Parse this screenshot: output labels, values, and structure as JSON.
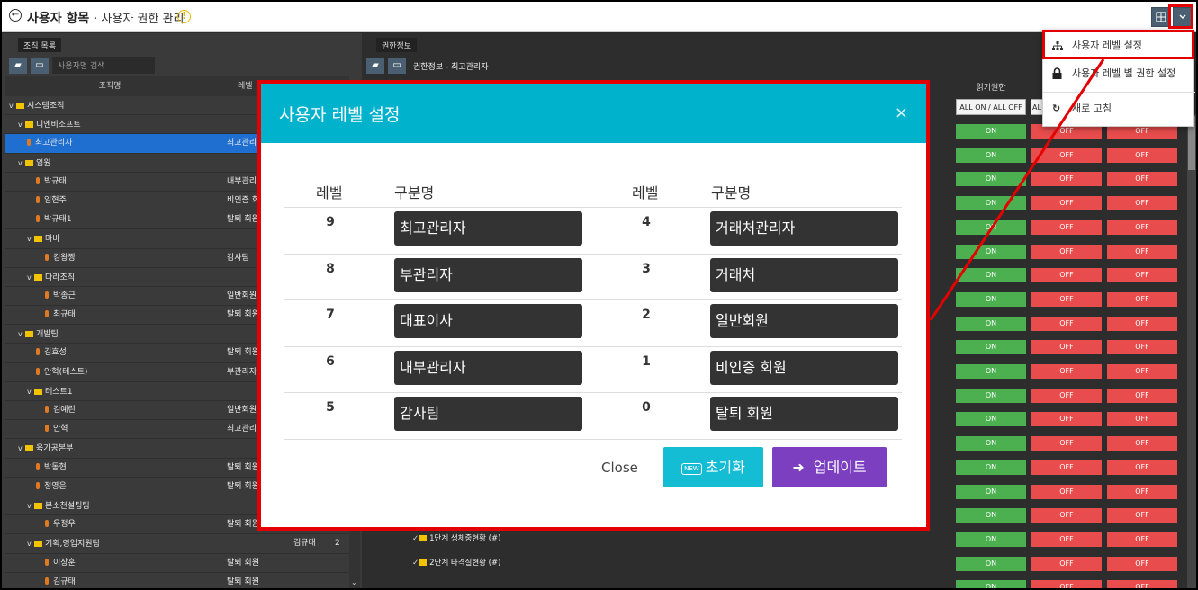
{
  "header": {
    "title": "사용자 항목",
    "subtitle": "· 사용자 권한 관리",
    "back_glyph": "←",
    "warn_glyph": "!"
  },
  "left_panel": {
    "tab": "조직 목록",
    "search_placeholder": "사용자명 검색",
    "col_name": "조직명",
    "col_level": "레벨",
    "rows": [
      {
        "name": "시스템조직",
        "type": "folder",
        "indent": 0,
        "level": ""
      },
      {
        "name": "디엔비소프트",
        "type": "folder",
        "indent": 1,
        "level": ""
      },
      {
        "name": "최고관리자",
        "type": "person",
        "indent": 2,
        "level": "최고관리",
        "selected": true
      },
      {
        "name": "임원",
        "type": "folder",
        "indent": 1,
        "level": ""
      },
      {
        "name": "박규태",
        "type": "person",
        "indent": 3,
        "level": "내부관리"
      },
      {
        "name": "임현주",
        "type": "person",
        "indent": 3,
        "level": "비인증 회"
      },
      {
        "name": "박규태1",
        "type": "person",
        "indent": 3,
        "level": "탈퇴 회원"
      },
      {
        "name": "마바",
        "type": "folder",
        "indent": 2,
        "level": ""
      },
      {
        "name": "킹왕짱",
        "type": "person",
        "indent": 4,
        "level": "감사팀"
      },
      {
        "name": "다라조직",
        "type": "folder",
        "indent": 2,
        "level": ""
      },
      {
        "name": "박종근",
        "type": "person",
        "indent": 4,
        "level": "일반회원"
      },
      {
        "name": "최규태",
        "type": "person",
        "indent": 4,
        "level": "탈퇴 회원"
      },
      {
        "name": "개발팀",
        "type": "folder",
        "indent": 1,
        "level": ""
      },
      {
        "name": "김효성",
        "type": "person",
        "indent": 3,
        "level": "탈퇴 회원"
      },
      {
        "name": "안혁(테스트)",
        "type": "person",
        "indent": 3,
        "level": "부관리자"
      },
      {
        "name": "테스트1",
        "type": "folder",
        "indent": 2,
        "level": ""
      },
      {
        "name": "김예린",
        "type": "person",
        "indent": 4,
        "level": "일반회원"
      },
      {
        "name": "안혁",
        "type": "person",
        "indent": 4,
        "level": "최고관리"
      },
      {
        "name": "육가공본부",
        "type": "folder",
        "indent": 1,
        "level": ""
      },
      {
        "name": "박동현",
        "type": "person",
        "indent": 3,
        "level": "탈퇴 회원"
      },
      {
        "name": "정영은",
        "type": "person",
        "indent": 3,
        "level": "탈퇴 회원"
      },
      {
        "name": "본소천설팅팀",
        "type": "folder",
        "indent": 2,
        "level": ""
      },
      {
        "name": "우정우",
        "type": "person",
        "indent": 4,
        "level": "탈퇴 회원"
      },
      {
        "name": "기획,영업지원팀",
        "type": "folder",
        "indent": 2,
        "level": "",
        "extra": "김규태",
        "extra2": "2"
      },
      {
        "name": "이상훈",
        "type": "person",
        "indent": 4,
        "level": "탈퇴 회원"
      },
      {
        "name": "김규태",
        "type": "person",
        "indent": 4,
        "level": "탈퇴 회원"
      }
    ]
  },
  "right_panel": {
    "tab": "권한정보",
    "breadcrumb": "권한정보 - 최고관리자",
    "read_col": "읽기권한",
    "all_toggle": "ALL ON / ALL OFF",
    "all_toggle_short": "AL",
    "on_label": "ON",
    "off_label": "OFF",
    "menu_rows": [
      {
        "label": "1단계 생체중현황 (#)"
      },
      {
        "label": "2단계 타격실현황 (#)"
      }
    ]
  },
  "dropdown": {
    "items": [
      {
        "label": "사용자 레벨 설정"
      },
      {
        "label": "사용자 레벨 별 권한 설정"
      },
      {
        "label": "새로 고침"
      }
    ]
  },
  "modal": {
    "title": "사용자 레벨 설정",
    "close_glyph": "×",
    "col_level": "레벨",
    "col_name": "구분명",
    "left_levels": [
      {
        "level": "9",
        "name": "최고관리자"
      },
      {
        "level": "8",
        "name": "부관리자"
      },
      {
        "level": "7",
        "name": "대표이사"
      },
      {
        "level": "6",
        "name": "내부관리자"
      },
      {
        "level": "5",
        "name": "감사팀"
      }
    ],
    "right_levels": [
      {
        "level": "4",
        "name": "거래처관리자"
      },
      {
        "level": "3",
        "name": "거래처"
      },
      {
        "level": "2",
        "name": "일반회원"
      },
      {
        "level": "1",
        "name": "비인증 회원"
      },
      {
        "level": "0",
        "name": "탈퇴 회원"
      }
    ],
    "close_label": "Close",
    "reset_badge": "NEW",
    "reset_label": "초기화",
    "update_label": "업데이트"
  },
  "colors": {
    "accent": "#00b2cc",
    "update": "#7b3fbf",
    "on": "#4caf50",
    "off": "#e84c4c",
    "highlight": "#e40000"
  }
}
